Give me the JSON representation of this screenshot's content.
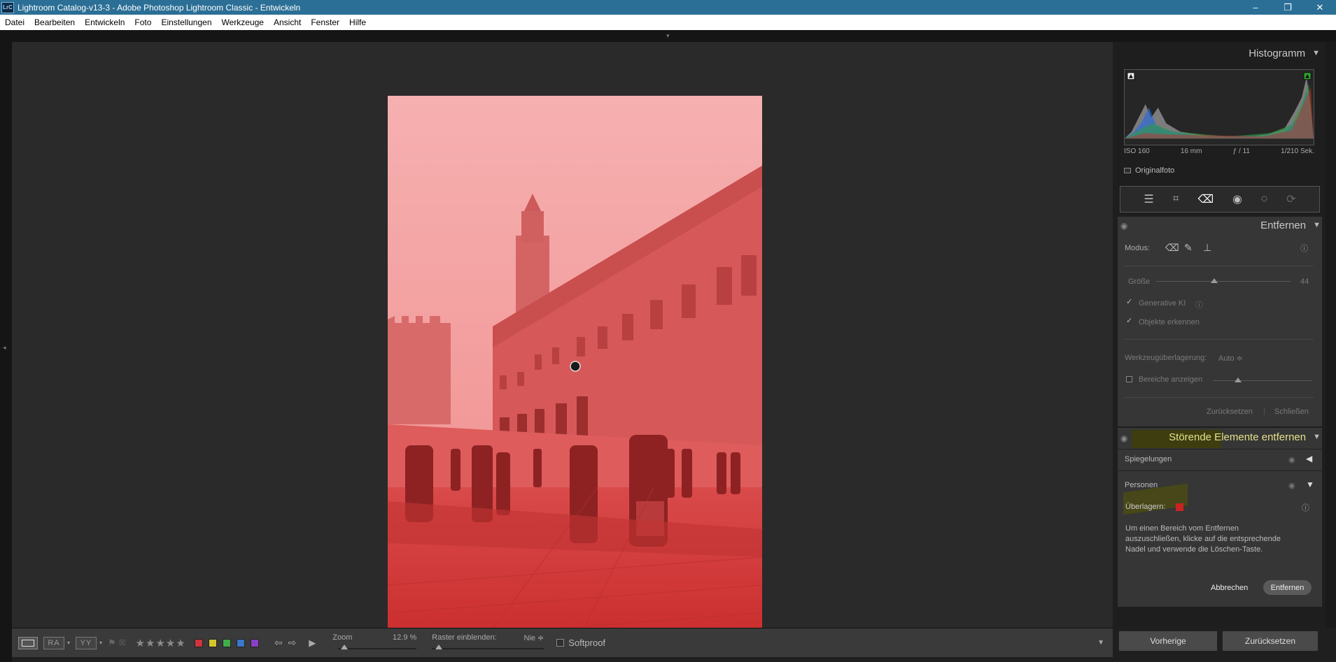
{
  "window": {
    "icon_label": "LrC",
    "title": "Lightroom Catalog-v13-3 - Adobe Photoshop Lightroom Classic - Entwickeln",
    "minimize": "–",
    "maximize": "❐",
    "close": "✕"
  },
  "menu": [
    "Datei",
    "Bearbeiten",
    "Entwickeln",
    "Foto",
    "Einstellungen",
    "Werkzeuge",
    "Ansicht",
    "Fenster",
    "Hilfe"
  ],
  "photo": {
    "overlay_color": "#e03b3b",
    "subject": "Piazza Maggiore street scene with red mask overlay"
  },
  "toolbar": {
    "view_icon_1": "RA",
    "view_icon_2": "YY",
    "stars": "★★★★★",
    "color_labels": [
      "#d0343a",
      "#d6c62e",
      "#3fae4a",
      "#3a78c9",
      "#8a3fc9"
    ],
    "zoom_label": "Zoom",
    "zoom_value": "12.9 %",
    "zoom_level": 0.08,
    "grid_label": "Raster einblenden:",
    "grid_value": "Nie ≑",
    "softproof": "Softproof"
  },
  "histogram": {
    "title": "Histogramm",
    "exif": {
      "iso": "ISO 160",
      "focal": "16 mm",
      "aperture": "ƒ / 11",
      "shutter": "1/210 Sek."
    },
    "original_label": "Originalfoto"
  },
  "remove_panel": {
    "title": "Entfernen",
    "mode_label": "Modus:",
    "size_label": "Größe",
    "size_value": "44",
    "size_level": 0.43,
    "generative_ai_label": "Generative KI",
    "detect_objects_label": "Objekte erkennen",
    "overlay_label": "Werkzeugüberlagerung:",
    "overlay_value": "Auto ≑",
    "show_areas_label": "Bereiche anzeigen",
    "show_areas_level": 0.25,
    "reset_label": "Zurücksetzen",
    "close_label": "Schließen"
  },
  "distractions_panel": {
    "title": "Störende Elemente entfernen",
    "reflections_label": "Spiegelungen",
    "people_label": "Personen",
    "overlay_label": "Überlagern:",
    "overlay_color": "#cc2222",
    "hint_text": "Um einen Bereich vom Entfernen auszuschließen, klicke auf die entsprechende Nadel und verwende die Löschen-Taste.",
    "cancel_label": "Abbrechen",
    "remove_label": "Entfernen"
  },
  "footer": {
    "previous_label": "Vorherige",
    "reset_label": "Zurücksetzen"
  }
}
